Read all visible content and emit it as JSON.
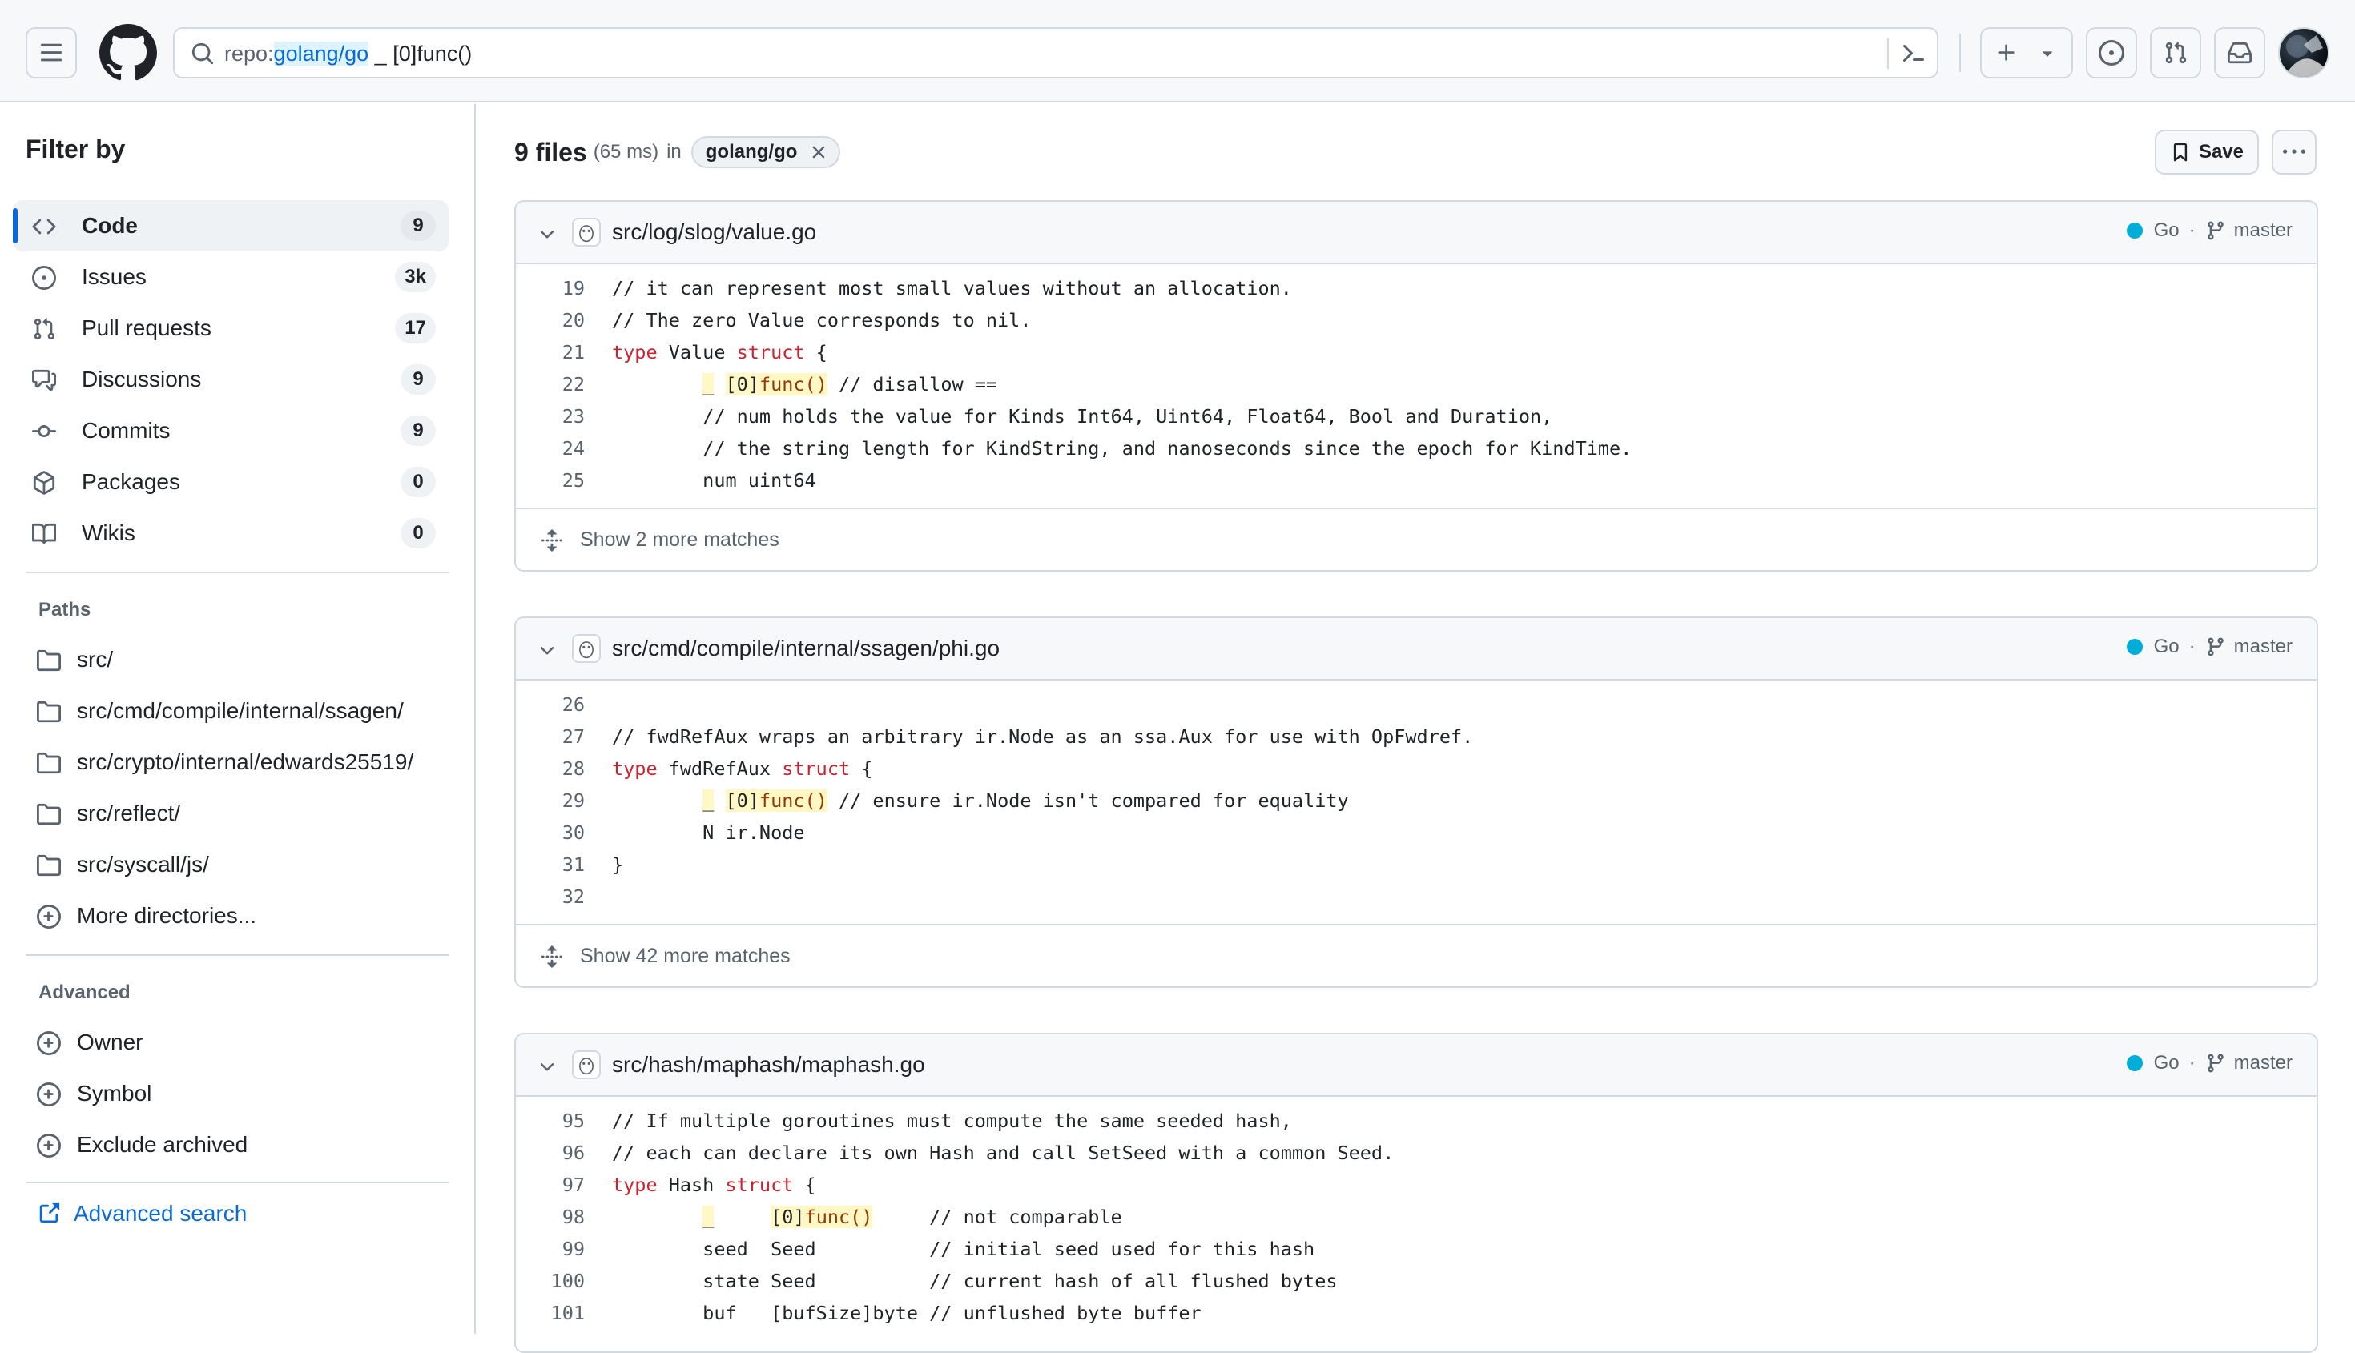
{
  "header": {
    "search_key": "repo:",
    "search_value": "golang/go",
    "search_rest": " _ [0]func()"
  },
  "sidebar": {
    "title": "Filter by",
    "nav": [
      {
        "label": "Code",
        "count": "9",
        "icon": "code-icon"
      },
      {
        "label": "Issues",
        "count": "3k",
        "icon": "issue-opened-icon"
      },
      {
        "label": "Pull requests",
        "count": "17",
        "icon": "git-pull-request-icon"
      },
      {
        "label": "Discussions",
        "count": "9",
        "icon": "comment-discussion-icon"
      },
      {
        "label": "Commits",
        "count": "9",
        "icon": "git-commit-icon"
      },
      {
        "label": "Packages",
        "count": "0",
        "icon": "package-icon"
      },
      {
        "label": "Wikis",
        "count": "0",
        "icon": "book-icon"
      }
    ],
    "paths_title": "Paths",
    "paths": [
      "src/",
      "src/cmd/compile/internal/ssagen/",
      "src/crypto/internal/edwards25519/",
      "src/reflect/",
      "src/syscall/js/"
    ],
    "more_dirs": "More directories...",
    "advanced_title": "Advanced",
    "advanced": [
      "Owner",
      "Symbol",
      "Exclude archived"
    ],
    "advanced_search": "Advanced search"
  },
  "results": {
    "count": "9 files",
    "time": "(65 ms)",
    "in": "in",
    "repo": "golang/go",
    "save": "Save"
  },
  "cards": [
    {
      "path": "src/log/slog/value.go",
      "lang": "Go",
      "lang_color": "#00add8",
      "branch": "master",
      "lines": [
        [
          "19",
          "// it can represent most small values without an allocation."
        ],
        [
          "20",
          "// The zero Value corresponds to nil."
        ],
        [
          "21",
          "type Value struct {"
        ],
        [
          "22",
          "        _ [0]func() // disallow =="
        ],
        [
          "23",
          "        // num holds the value for Kinds Int64, Uint64, Float64, Bool and Duration,"
        ],
        [
          "24",
          "        // the string length for KindString, and nanoseconds since the epoch for KindTime."
        ],
        [
          "25",
          "        num uint64"
        ]
      ],
      "more": "Show 2 more matches"
    },
    {
      "path": "src/cmd/compile/internal/ssagen/phi.go",
      "lang": "Go",
      "lang_color": "#00add8",
      "branch": "master",
      "lines": [
        [
          "26",
          ""
        ],
        [
          "27",
          "// fwdRefAux wraps an arbitrary ir.Node as an ssa.Aux for use with OpFwdref."
        ],
        [
          "28",
          "type fwdRefAux struct {"
        ],
        [
          "29",
          "        _ [0]func() // ensure ir.Node isn't compared for equality"
        ],
        [
          "30",
          "        N ir.Node"
        ],
        [
          "31",
          "}"
        ],
        [
          "32",
          ""
        ]
      ],
      "more": "Show 42 more matches"
    },
    {
      "path": "src/hash/maphash/maphash.go",
      "lang": "Go",
      "lang_color": "#00add8",
      "branch": "master",
      "lines": [
        [
          "95",
          "// If multiple goroutines must compute the same seeded hash,"
        ],
        [
          "96",
          "// each can declare its own Hash and call SetSeed with a common Seed."
        ],
        [
          "97",
          "type Hash struct {"
        ],
        [
          "98",
          "        _     [0]func()     // not comparable"
        ],
        [
          "99",
          "        seed  Seed          // initial seed used for this hash"
        ],
        [
          "100",
          "        state Seed          // current hash of all flushed bytes"
        ],
        [
          "101",
          "        buf   [bufSize]byte // unflushed byte buffer"
        ]
      ],
      "more": ""
    }
  ]
}
